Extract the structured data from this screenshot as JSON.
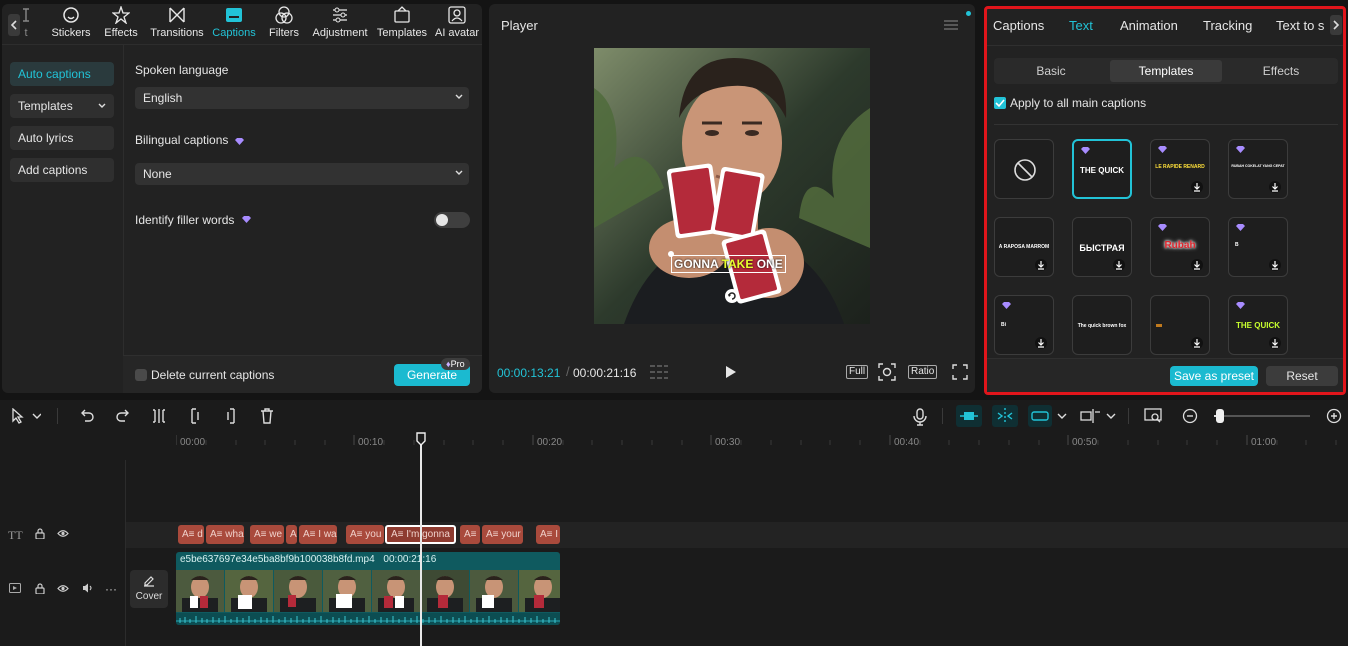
{
  "toolbar": {
    "items": [
      {
        "label": "t",
        "icon": "text-icon"
      },
      {
        "label": "Stickers",
        "icon": "sticker-icon"
      },
      {
        "label": "Effects",
        "icon": "effects-star-icon"
      },
      {
        "label": "Transitions",
        "icon": "transition-icon"
      },
      {
        "label": "Captions",
        "icon": "captions-icon",
        "active": true
      },
      {
        "label": "Filters",
        "icon": "filters-icon"
      },
      {
        "label": "Adjustment",
        "icon": "adjustment-sliders-icon"
      },
      {
        "label": "Templates",
        "icon": "templates-icon"
      },
      {
        "label": "AI avatar",
        "icon": "ai-avatar-icon"
      }
    ]
  },
  "left_nav": {
    "auto_captions": "Auto captions",
    "templates": "Templates",
    "auto_lyrics": "Auto lyrics",
    "add_captions": "Add captions"
  },
  "captions_settings": {
    "spoken_language_label": "Spoken language",
    "spoken_language_value": "English",
    "bilingual_label": "Bilingual captions",
    "bilingual_value": "None",
    "filler_label": "Identify filler words",
    "delete_label": "Delete current captions",
    "generate_label": "Generate",
    "pro_badge": "Pro"
  },
  "player": {
    "title": "Player",
    "caption_words": [
      "GONNA",
      "TAKE",
      "ONE"
    ],
    "current_time": "00:00:13:21",
    "total_time": "00:00:21:16",
    "full_label": "Full",
    "ratio_label": "Ratio"
  },
  "right_panel": {
    "tabs": [
      "Captions",
      "Text",
      "Animation",
      "Tracking",
      "Text to s"
    ],
    "active_tab": "Text",
    "segments": [
      "Basic",
      "Templates",
      "Effects"
    ],
    "active_segment": "Templates",
    "apply_all_label": "Apply to all main captions",
    "templates": [
      {
        "text": "",
        "kind": "none"
      },
      {
        "text": "THE QUICK",
        "kind": "selected"
      },
      {
        "text": "LE RAPIDE RENARD",
        "kind": "pro"
      },
      {
        "text": "RUBAH COKELAT YANG CEPAT",
        "kind": "pro"
      },
      {
        "text": "A RAPOSA MARROM",
        "kind": "pro"
      },
      {
        "text": "БЫСТРАЯ",
        "kind": "free"
      },
      {
        "text": "Rubah",
        "kind": "pro"
      },
      {
        "text": "B",
        "kind": "pro"
      },
      {
        "text": "Bi",
        "kind": "pro"
      },
      {
        "text": "The quick brown fox",
        "kind": "free"
      },
      {
        "text": "",
        "kind": "free"
      },
      {
        "text": "THE QUICK",
        "kind": "pro"
      }
    ],
    "save_preset_label": "Save as preset",
    "reset_label": "Reset",
    "accent": "#22c3d7",
    "highlight_border": "#e0151b"
  },
  "timeline": {
    "ruler": [
      "00:00",
      "00:10",
      "00:20",
      "00:30",
      "00:40",
      "00:50",
      "01:00"
    ],
    "caption_clips": [
      {
        "text": "A≡ d"
      },
      {
        "text": "A≡ wha"
      },
      {
        "text": "A≡ we"
      },
      {
        "text": "A"
      },
      {
        "text": "A≡ I wa"
      },
      {
        "text": "A≡ you"
      },
      {
        "text": "A≡ I'm gonna",
        "selected": true
      },
      {
        "text": "A≡"
      },
      {
        "text": "A≡ your"
      },
      {
        "text": "A≡ I"
      }
    ],
    "video_clip": {
      "filename": "e5be637697e34e5ba8bf9b100038b8fd.mp4",
      "duration": "00:00:21:16"
    },
    "cover_label": "Cover",
    "track_text_label": "TT"
  }
}
